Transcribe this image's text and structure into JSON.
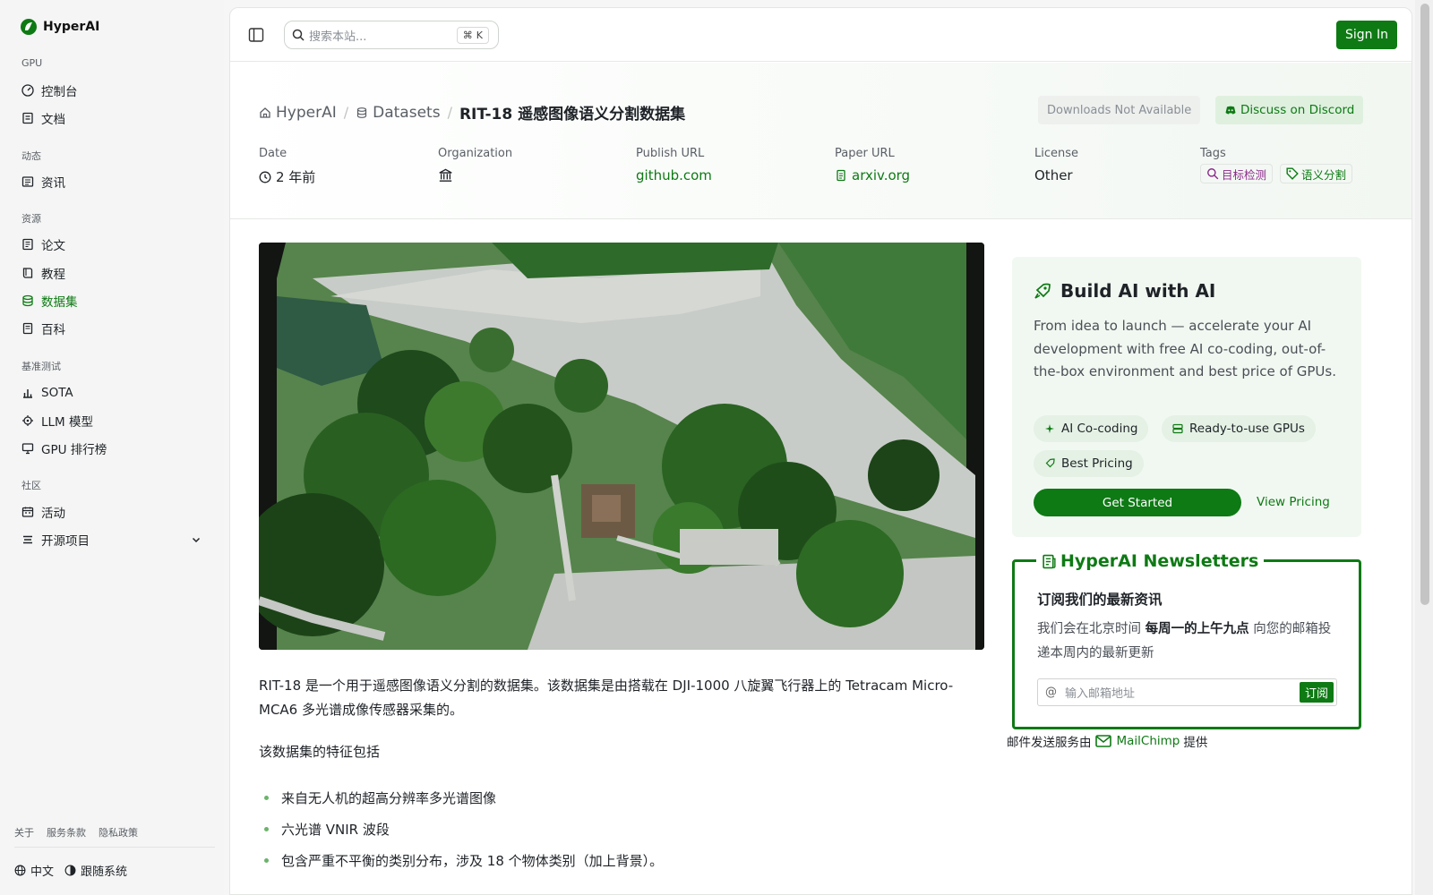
{
  "brand": {
    "name": "HyperAI",
    "color": "#0e7a14"
  },
  "sidebar": {
    "sections": [
      {
        "title": "GPU",
        "items": [
          {
            "label": "控制台",
            "icon": "gauge-icon"
          },
          {
            "label": "文档",
            "icon": "doc-icon"
          }
        ]
      },
      {
        "title": "动态",
        "items": [
          {
            "label": "资讯",
            "icon": "news-icon"
          }
        ]
      },
      {
        "title": "资源",
        "items": [
          {
            "label": "论文",
            "icon": "paper-icon"
          },
          {
            "label": "教程",
            "icon": "book-icon"
          },
          {
            "label": "数据集",
            "icon": "database-icon",
            "active": true
          },
          {
            "label": "百科",
            "icon": "wiki-icon"
          }
        ]
      },
      {
        "title": "基准测试",
        "items": [
          {
            "label": "SOTA",
            "icon": "bar-chart-icon"
          },
          {
            "label": "LLM 模型",
            "icon": "chip-icon"
          },
          {
            "label": "GPU 排行榜",
            "icon": "monitor-icon"
          }
        ]
      },
      {
        "title": "社区",
        "items": [
          {
            "label": "活动",
            "icon": "calendar-icon"
          },
          {
            "label": "开源项目",
            "icon": "list-icon"
          }
        ]
      }
    ],
    "footer_links": [
      "关于",
      "服务条款",
      "隐私政策"
    ],
    "language": "中文",
    "theme": "跟随系统"
  },
  "topbar": {
    "search_placeholder": "搜索本站...",
    "shortcut": "K",
    "sign_in": "Sign In"
  },
  "breadcrumb": {
    "home": "HyperAI",
    "section": "Datasets",
    "current": "RIT-18 遥感图像语义分割数据集"
  },
  "actions": {
    "downloads": "Downloads Not Available",
    "discord": "Discuss on Discord"
  },
  "meta": {
    "date_label": "Date",
    "date_value": "2 年前",
    "org_label": "Organization",
    "publish_label": "Publish URL",
    "publish_value": "github.com",
    "paper_label": "Paper URL",
    "paper_value": "arxiv.org",
    "license_label": "License",
    "license_value": "Other",
    "tags_label": "Tags",
    "tags": [
      {
        "label": "目标检测",
        "color": "#8a2a8a"
      },
      {
        "label": "语义分割",
        "color": "#0e7a14"
      }
    ]
  },
  "content": {
    "description": "RIT-18  是一个用于遥感图像语义分割的数据集。该数据集是由搭载在 DJI-1000 八旋翼飞行器上的 Tetracam Micro-MCA6 多光谱成像传感器采集的。",
    "features_title": "该数据集的特征包括",
    "bullets": [
      "来自无人机的超高分辨率多光谱图像",
      "六光谱 VNIR 波段",
      "包含严重不平衡的类别分布，涉及 18 个物体类别（加上背景）。"
    ]
  },
  "promo": {
    "title": "Build AI with AI",
    "text": "From idea to launch — accelerate your AI development with free AI co-coding, out-of-the-box environment and best price of GPUs.",
    "pills": [
      "AI Co-coding",
      "Ready-to-use GPUs",
      "Best Pricing"
    ],
    "cta": "Get Started",
    "pricing": "View Pricing"
  },
  "newsletter": {
    "title": "HyperAI Newsletters",
    "heading": "订阅我们的最新资讯",
    "text_pre": "我们会在北京时间 ",
    "text_bold": "每周一的上午九点",
    "text_post": " 向您的邮箱投递本周内的最新更新",
    "email_placeholder": "输入邮箱地址",
    "subscribe": "订阅",
    "mail_pre": "邮件发送服务由",
    "mail_brand": "MailChimp",
    "mail_post": "提供"
  }
}
